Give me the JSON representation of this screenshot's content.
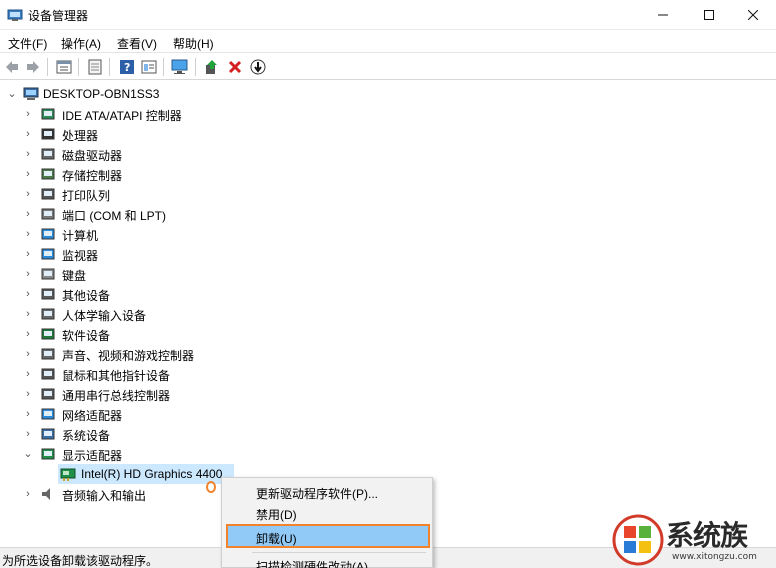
{
  "window": {
    "title": "设备管理器"
  },
  "menu": [
    "文件(F)",
    "操作(A)",
    "查看(V)",
    "帮助(H)"
  ],
  "toolbar_icons": [
    "back-icon",
    "forward-icon",
    "properties-icon",
    "refresh-icon",
    "help-icon",
    "view-icon",
    "monitor-icon",
    "update-driver-icon",
    "uninstall-icon",
    "disable-icon"
  ],
  "tree": {
    "root": "DESKTOP-OBN1SS3",
    "categories": [
      {
        "label": "IDE ATA/ATAPI 控制器",
        "icon": "ide-controller-icon"
      },
      {
        "label": "处理器",
        "icon": "processor-icon"
      },
      {
        "label": "磁盘驱动器",
        "icon": "disk-drive-icon"
      },
      {
        "label": "存储控制器",
        "icon": "storage-controller-icon"
      },
      {
        "label": "打印队列",
        "icon": "printer-icon"
      },
      {
        "label": "端口 (COM 和 LPT)",
        "icon": "port-icon"
      },
      {
        "label": "计算机",
        "icon": "computer-icon"
      },
      {
        "label": "监视器",
        "icon": "monitor-icon"
      },
      {
        "label": "键盘",
        "icon": "keyboard-icon"
      },
      {
        "label": "其他设备",
        "icon": "other-device-icon"
      },
      {
        "label": "人体学输入设备",
        "icon": "hid-icon"
      },
      {
        "label": "软件设备",
        "icon": "software-device-icon"
      },
      {
        "label": "声音、视频和游戏控制器",
        "icon": "sound-icon"
      },
      {
        "label": "鼠标和其他指针设备",
        "icon": "mouse-icon"
      },
      {
        "label": "通用串行总线控制器",
        "icon": "usb-icon"
      },
      {
        "label": "网络适配器",
        "icon": "network-icon"
      },
      {
        "label": "系统设备",
        "icon": "system-device-icon"
      },
      {
        "label": "显示适配器",
        "icon": "display-adapter-icon"
      }
    ],
    "display_child": "Intel(R) HD Graphics 4400",
    "last_category": "音频输入和输出"
  },
  "context_menu": {
    "items": [
      "更新驱动程序软件(P)...",
      "禁用(D)",
      "卸载(U)",
      "扫描检测硬件改动(A)"
    ],
    "highlighted": "卸载(U)",
    "highlight_color": "#91c9f7",
    "outline_color": "#f0832c"
  },
  "status": {
    "text": "为所选设备卸载该驱动程序。"
  },
  "watermark": {
    "text": "系统族",
    "url": "www.xitongzu.com"
  }
}
